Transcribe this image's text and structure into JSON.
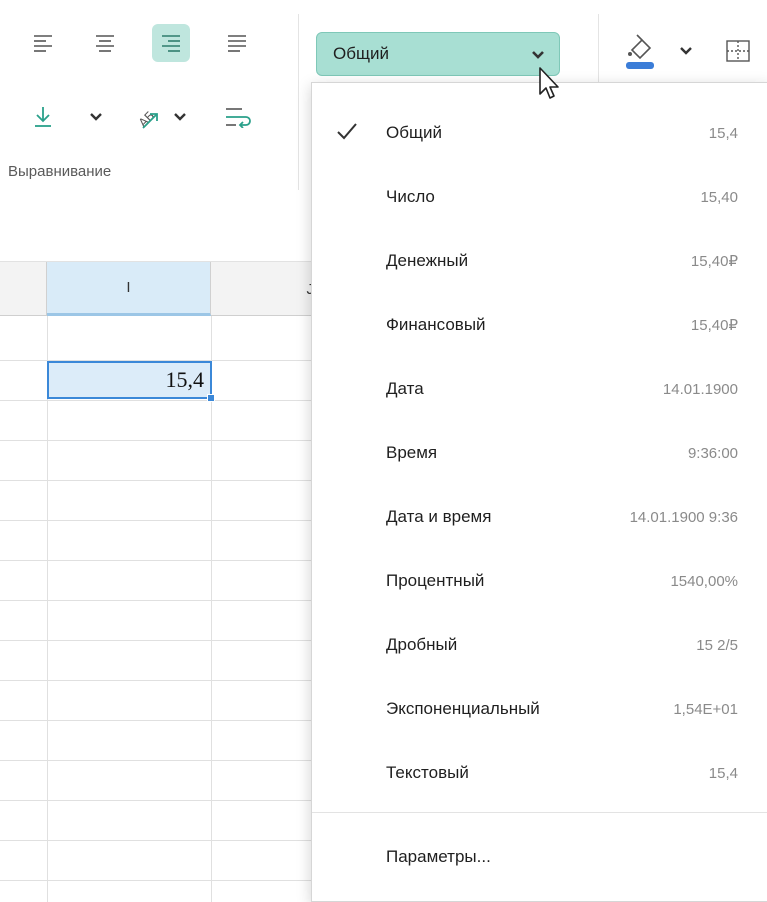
{
  "toolbar": {
    "group_label": "Выравнивание",
    "accent_color": "#a8dfd3",
    "icons": [
      "align-left-icon",
      "align-center-icon",
      "align-right-icon",
      "align-justify-icon",
      "align-bottom-icon",
      "chevron-down-icon",
      "text-rotate-icon",
      "chevron-down-icon",
      "wrap-text-icon",
      "fill-color-icon",
      "chevron-down-icon",
      "borders-icon"
    ]
  },
  "number_format": {
    "selected": "Общий"
  },
  "grid": {
    "columns": [
      "I",
      "J"
    ],
    "active_cell_value": "15,4",
    "selection_color": "#3b88d8"
  },
  "dropdown": {
    "items": [
      {
        "label": "Общий",
        "sample": "15,4",
        "checked": true
      },
      {
        "label": "Число",
        "sample": "15,40",
        "checked": false
      },
      {
        "label": "Денежный",
        "sample": "15,40₽",
        "checked": false
      },
      {
        "label": "Финансовый",
        "sample": "15,40₽",
        "checked": false
      },
      {
        "label": "Дата",
        "sample": "14.01.1900",
        "checked": false
      },
      {
        "label": "Время",
        "sample": "9:36:00",
        "checked": false
      },
      {
        "label": "Дата и время",
        "sample": "14.01.1900 9:36",
        "checked": false
      },
      {
        "label": "Процентный",
        "sample": "1540,00%",
        "checked": false
      },
      {
        "label": "Дробный",
        "sample": "15 2/5",
        "checked": false
      },
      {
        "label": "Экспоненциальный",
        "sample": "1,54E+01",
        "checked": false
      },
      {
        "label": "Текстовый",
        "sample": "15,4",
        "checked": false
      }
    ],
    "footer": "Параметры..."
  }
}
